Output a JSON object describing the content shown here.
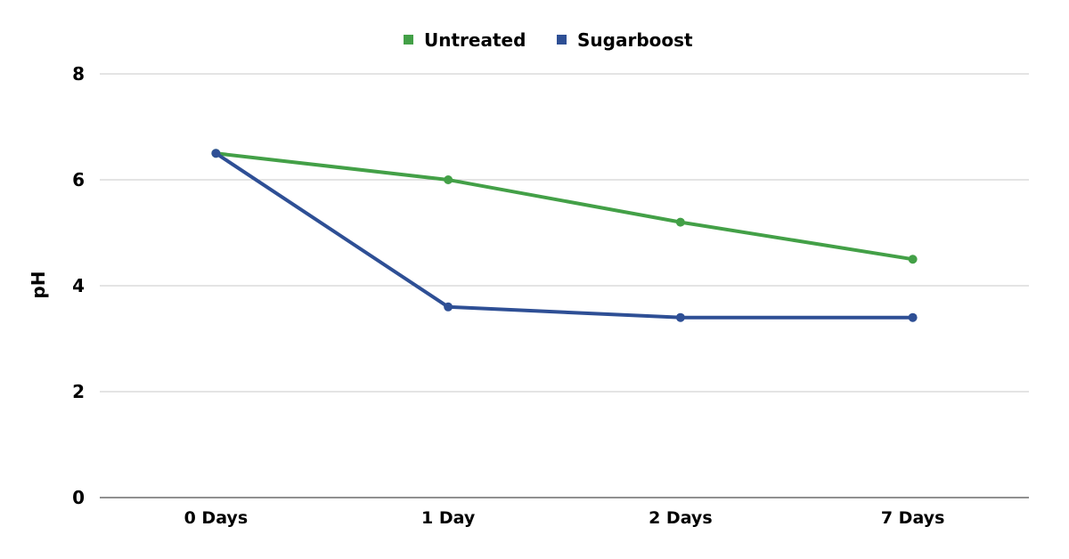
{
  "chart_data": {
    "type": "line",
    "title": "",
    "xlabel": "",
    "ylabel": "pH",
    "categories": [
      "0 Days",
      "1 Day",
      "2 Days",
      "7 Days"
    ],
    "ylim": [
      0,
      8
    ],
    "yticks": [
      0,
      2,
      4,
      6,
      8
    ],
    "grid": true,
    "legend_position": "top-center",
    "series": [
      {
        "name": "Untreated",
        "color": "#43a047",
        "values": [
          6.5,
          6.0,
          5.2,
          4.5
        ]
      },
      {
        "name": "Sugarboost",
        "color": "#2e4f95",
        "values": [
          6.5,
          3.6,
          3.4,
          3.4
        ]
      }
    ]
  }
}
